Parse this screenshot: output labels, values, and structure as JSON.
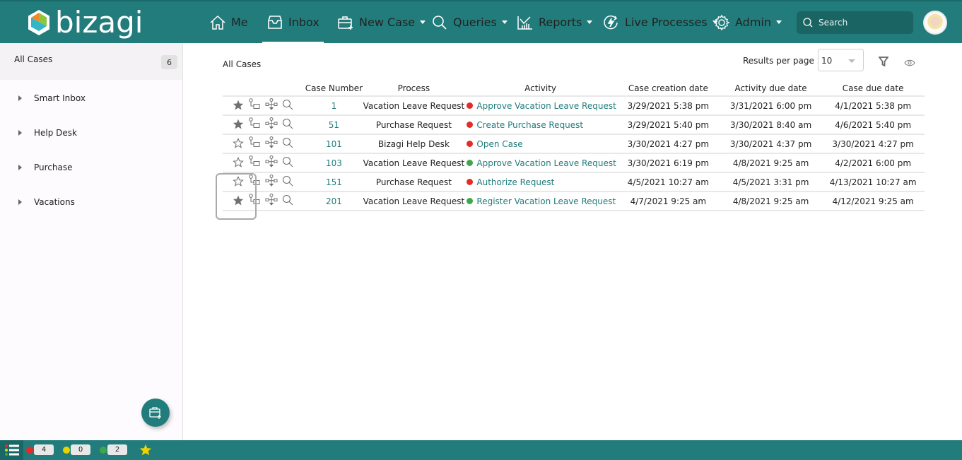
{
  "app": {
    "brand": "bizagi"
  },
  "nav": {
    "items": [
      {
        "label": "Me",
        "icon": "home-icon",
        "dropdown": false,
        "active": false
      },
      {
        "label": "Inbox",
        "icon": "inbox-icon",
        "dropdown": false,
        "active": true
      },
      {
        "label": "New Case",
        "icon": "new-case-icon",
        "dropdown": true,
        "active": false
      },
      {
        "label": "Queries",
        "icon": "search-icon",
        "dropdown": true,
        "active": false
      },
      {
        "label": "Reports",
        "icon": "chart-icon",
        "dropdown": true,
        "active": false
      },
      {
        "label": "Live Processes",
        "icon": "lightning-icon",
        "dropdown": true,
        "active": false
      },
      {
        "label": "Admin",
        "icon": "gear-icon",
        "dropdown": true,
        "active": false
      }
    ],
    "search_placeholder": "Search"
  },
  "sidebar": {
    "header": {
      "label": "All Cases",
      "count": "6"
    },
    "items": [
      {
        "label": "Smart Inbox"
      },
      {
        "label": "Help Desk"
      },
      {
        "label": "Purchase"
      },
      {
        "label": "Vacations"
      }
    ]
  },
  "main": {
    "title": "All Cases",
    "results_per_page_label": "Results per page",
    "results_per_page_value": "10",
    "columns": [
      "",
      "Case Number",
      "Process",
      "Activity",
      "Case creation date",
      "Activity due date",
      "Case due date"
    ],
    "rows": [
      {
        "favorite": true,
        "case_number": "1",
        "process": "Vacation Leave Request",
        "status": "red",
        "activity": "Approve Vacation Leave Request",
        "created": "3/29/2021 5:38 pm",
        "activity_due": "3/31/2021 6:00 pm",
        "case_due": "4/1/2021 5:38 pm"
      },
      {
        "favorite": true,
        "case_number": "51",
        "process": "Purchase Request",
        "status": "red",
        "activity": "Create Purchase Request",
        "created": "3/29/2021 5:40 pm",
        "activity_due": "3/30/2021 8:40 am",
        "case_due": "4/6/2021 5:40 pm"
      },
      {
        "favorite": false,
        "case_number": "101",
        "process": "Bizagi Help Desk",
        "status": "red",
        "activity": "Open Case",
        "created": "3/30/2021 4:27 pm",
        "activity_due": "3/30/2021 4:37 pm",
        "case_due": "3/30/2021 4:27 pm"
      },
      {
        "favorite": false,
        "case_number": "103",
        "process": "Vacation Leave Request",
        "status": "green",
        "activity": "Approve Vacation Leave Request",
        "created": "3/30/2021 6:19 pm",
        "activity_due": "4/8/2021 9:25 am",
        "case_due": "4/2/2021 6:00 pm"
      },
      {
        "favorite": false,
        "case_number": "151",
        "process": "Purchase Request",
        "status": "red",
        "activity": "Authorize Request",
        "created": "4/5/2021 10:27 am",
        "activity_due": "4/5/2021 3:31 pm",
        "case_due": "4/13/2021 10:27 am"
      },
      {
        "favorite": true,
        "case_number": "201",
        "process": "Vacation Leave Request",
        "status": "green",
        "activity": "Register Vacation Leave Request",
        "created": "4/7/2021 9:25 am",
        "activity_due": "4/8/2021 9:25 am",
        "case_due": "4/12/2021 9:25 am"
      }
    ]
  },
  "footer": {
    "red_count": "4",
    "yellow_count": "0",
    "green_count": "2"
  },
  "colors": {
    "brand": "#217c7b",
    "status_red": "#e52a2a",
    "status_yellow": "#e6d400",
    "status_green": "#3fa74a",
    "star": "#f0d400",
    "icon_gray": "#707070"
  }
}
